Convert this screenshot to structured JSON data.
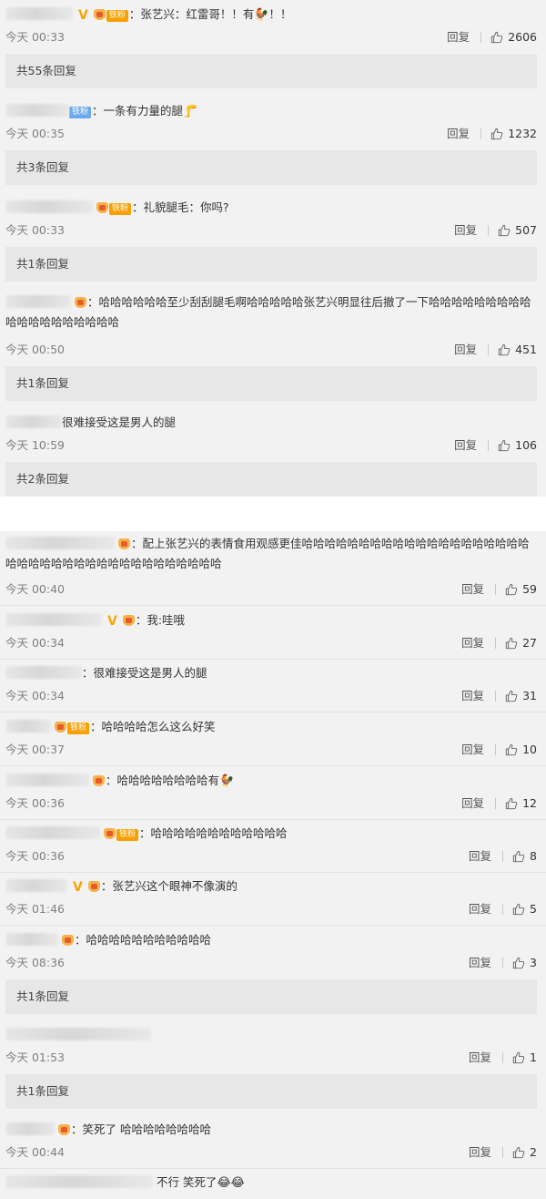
{
  "comments": [
    {
      "text": "：张艺兴：红雷哥！！有",
      "emoji": "🐓",
      "tail": "！！",
      "time": "今天 00:33",
      "reply_label": "回复",
      "likes": "2606",
      "replies": "共55条回复"
    },
    {
      "text": "：一条有力量的腿",
      "emoji": "🦵",
      "time": "今天 00:35",
      "reply_label": "回复",
      "likes": "1232",
      "replies": "共3条回复"
    },
    {
      "text": "：礼貌腿毛：你吗?",
      "time": "今天 00:33",
      "reply_label": "回复",
      "likes": "507",
      "replies": "共1条回复"
    },
    {
      "text": "：哈哈哈哈哈哈至少刮刮腿毛啊哈哈哈哈哈张艺兴明显往后撤了一下哈哈哈哈哈哈哈哈哈哈哈哈哈哈哈哈哈哈哈",
      "time": "今天 00:50",
      "reply_label": "回复",
      "likes": "451",
      "replies": "共1条回复"
    },
    {
      "text": "很难接受这是男人的腿",
      "time": "今天 10:59",
      "reply_label": "回复",
      "likes": "106",
      "replies": "共2条回复"
    },
    {
      "text": "：配上张艺兴的表情食用观感更佳哈哈哈哈哈哈哈哈哈哈哈哈哈哈哈哈哈哈哈哈哈哈哈哈哈哈哈哈哈哈哈哈哈哈哈哈哈哈哈",
      "time": "今天 00:40",
      "reply_label": "回复",
      "likes": "59"
    },
    {
      "text": "：我:哇哦",
      "time": "今天 00:34",
      "reply_label": "回复",
      "likes": "27"
    },
    {
      "text": "：很难接受这是男人的腿",
      "time": "今天 00:34",
      "reply_label": "回复",
      "likes": "31"
    },
    {
      "text": "：哈哈哈哈怎么这么好笑",
      "time": "今天 00:37",
      "reply_label": "回复",
      "likes": "10"
    },
    {
      "text": "：哈哈哈哈哈哈哈哈有",
      "emoji": "🐓",
      "time": "今天 00:36",
      "reply_label": "回复",
      "likes": "12"
    },
    {
      "text": "：哈哈哈哈哈哈哈哈哈哈哈哈",
      "time": "今天 00:36",
      "reply_label": "回复",
      "likes": "8"
    },
    {
      "text": "：张艺兴这个眼神不像演的",
      "time": "今天 01:46",
      "reply_label": "回复",
      "likes": "5"
    },
    {
      "text": "：哈哈哈哈哈哈哈哈哈哈哈",
      "time": "今天 08:36",
      "reply_label": "回复",
      "likes": "3",
      "replies": "共1条回复"
    },
    {
      "text": "",
      "time": "今天 01:53",
      "reply_label": "回复",
      "likes": "1",
      "replies": "共1条回复"
    },
    {
      "text": "：笑死了 哈哈哈哈哈哈哈哈",
      "time": "今天 00:44",
      "reply_label": "回复",
      "likes": "2"
    },
    {
      "text": "不行 笑死了",
      "emoji": "😂😂"
    }
  ],
  "fan_badge_label": "铁粉",
  "vip_mark": "V"
}
